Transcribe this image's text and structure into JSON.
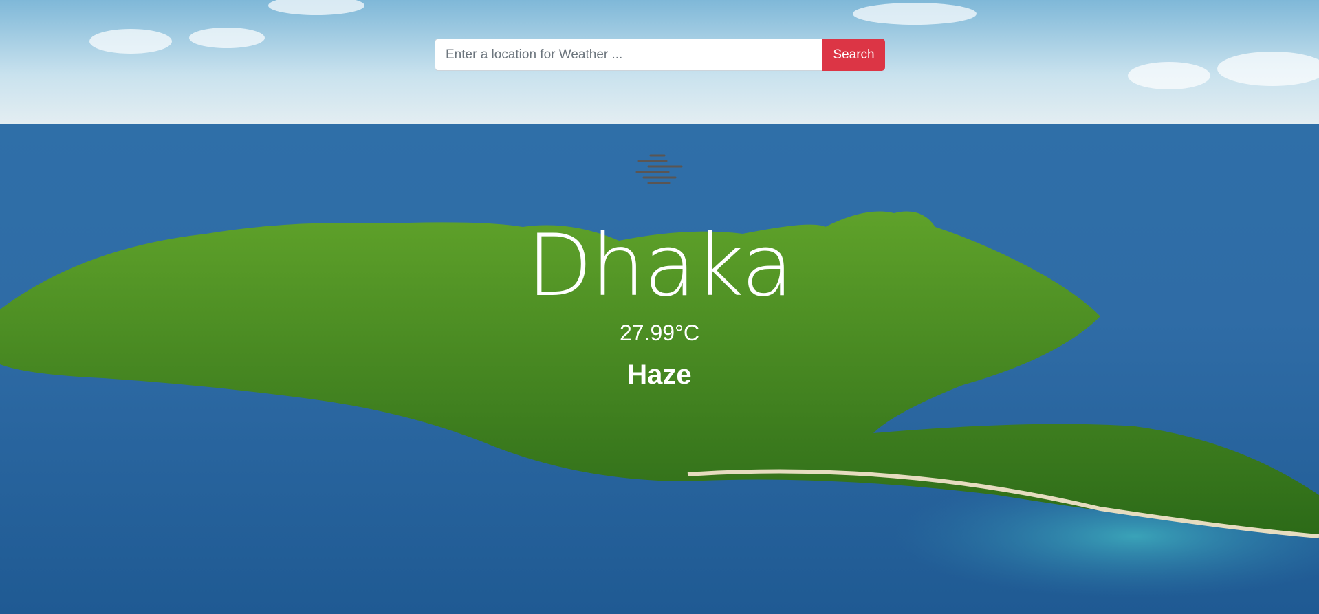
{
  "search": {
    "placeholder": "Enter a location for Weather ...",
    "value": "",
    "button_label": "Search"
  },
  "weather": {
    "icon": "haze-icon",
    "city": "Dhaka",
    "temperature": "27.99°C",
    "condition": "Haze"
  },
  "colors": {
    "accent": "#dc3545",
    "icon": "#5a5553"
  }
}
